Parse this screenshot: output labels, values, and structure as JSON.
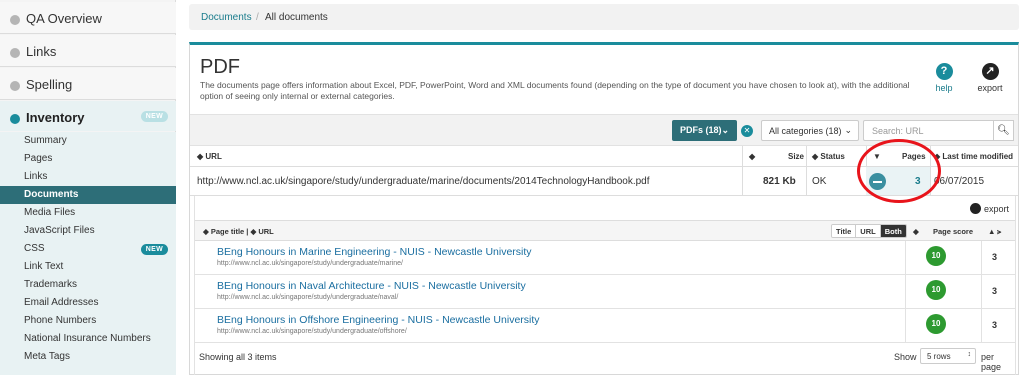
{
  "sidebar": {
    "sections": [
      {
        "label": "QA Overview"
      },
      {
        "label": "Links"
      },
      {
        "label": "Spelling"
      },
      {
        "label": "Inventory",
        "badge": "NEW"
      }
    ],
    "inventory_items": [
      {
        "label": "Summary"
      },
      {
        "label": "Pages"
      },
      {
        "label": "Links"
      },
      {
        "label": "Documents",
        "current": true
      },
      {
        "label": "Media Files"
      },
      {
        "label": "JavaScript Files"
      },
      {
        "label": "CSS",
        "badge": "NEW"
      },
      {
        "label": "Link Text"
      },
      {
        "label": "Trademarks"
      },
      {
        "label": "Email Addresses"
      },
      {
        "label": "Phone Numbers"
      },
      {
        "label": "National Insurance Numbers"
      },
      {
        "label": "Meta Tags"
      }
    ]
  },
  "breadcrumb": {
    "root": "Documents",
    "separator": "/",
    "current": "All documents"
  },
  "page": {
    "title": "PDF",
    "description": "The documents page offers information about Excel, PDF, PowerPoint, Word and XML documents found (depending on the type of document you have chosen to look at), with the additional option of seeing only internal or external categories.",
    "help_label": "help",
    "export_label": "export"
  },
  "filters": {
    "type_label": "PDFs (18)",
    "category_label": "All categories (18)",
    "search_placeholder": "Search: URL"
  },
  "table": {
    "headers": {
      "url": "URL",
      "size": "Size",
      "status": "Status",
      "pages": "Pages",
      "modified": "Last time modified"
    },
    "row": {
      "url": "http://www.ncl.ac.uk/singapore/study/undergraduate/marine/documents/2014TechnologyHandbook.pdf",
      "size": "821 Kb",
      "status": "OK",
      "pages": "3",
      "modified": "06/07/2015"
    }
  },
  "nested": {
    "export_label": "export",
    "headers": {
      "title_url": "Page title | ◆ URL",
      "score": "Page score"
    },
    "view_modes": [
      "Title",
      "URL",
      "Both"
    ],
    "active_mode": "Both",
    "rows": [
      {
        "title": "BEng Honours in Marine Engineering - NUIS - Newcastle University",
        "url": "http://www.ncl.ac.uk/singapore/study/undergraduate/marine/",
        "score": "10",
        "pages": "3"
      },
      {
        "title": "BEng Honours in Naval Architecture - NUIS - Newcastle University",
        "url": "http://www.ncl.ac.uk/singapore/study/undergraduate/naval/",
        "score": "10",
        "pages": "3"
      },
      {
        "title": "BEng Honours in Offshore Engineering - NUIS - Newcastle University",
        "url": "http://www.ncl.ac.uk/singapore/study/undergraduate/offshore/",
        "score": "10",
        "pages": "3"
      }
    ],
    "footer": {
      "showing": "Showing all 3 items",
      "show": "Show",
      "rows_option": "5 rows",
      "per_page": "per page"
    }
  },
  "colors": {
    "accent": "#1a8c9c",
    "current_item": "#2d6e78",
    "score_green": "#2d9a30",
    "highlight_ring": "#e8141b"
  }
}
